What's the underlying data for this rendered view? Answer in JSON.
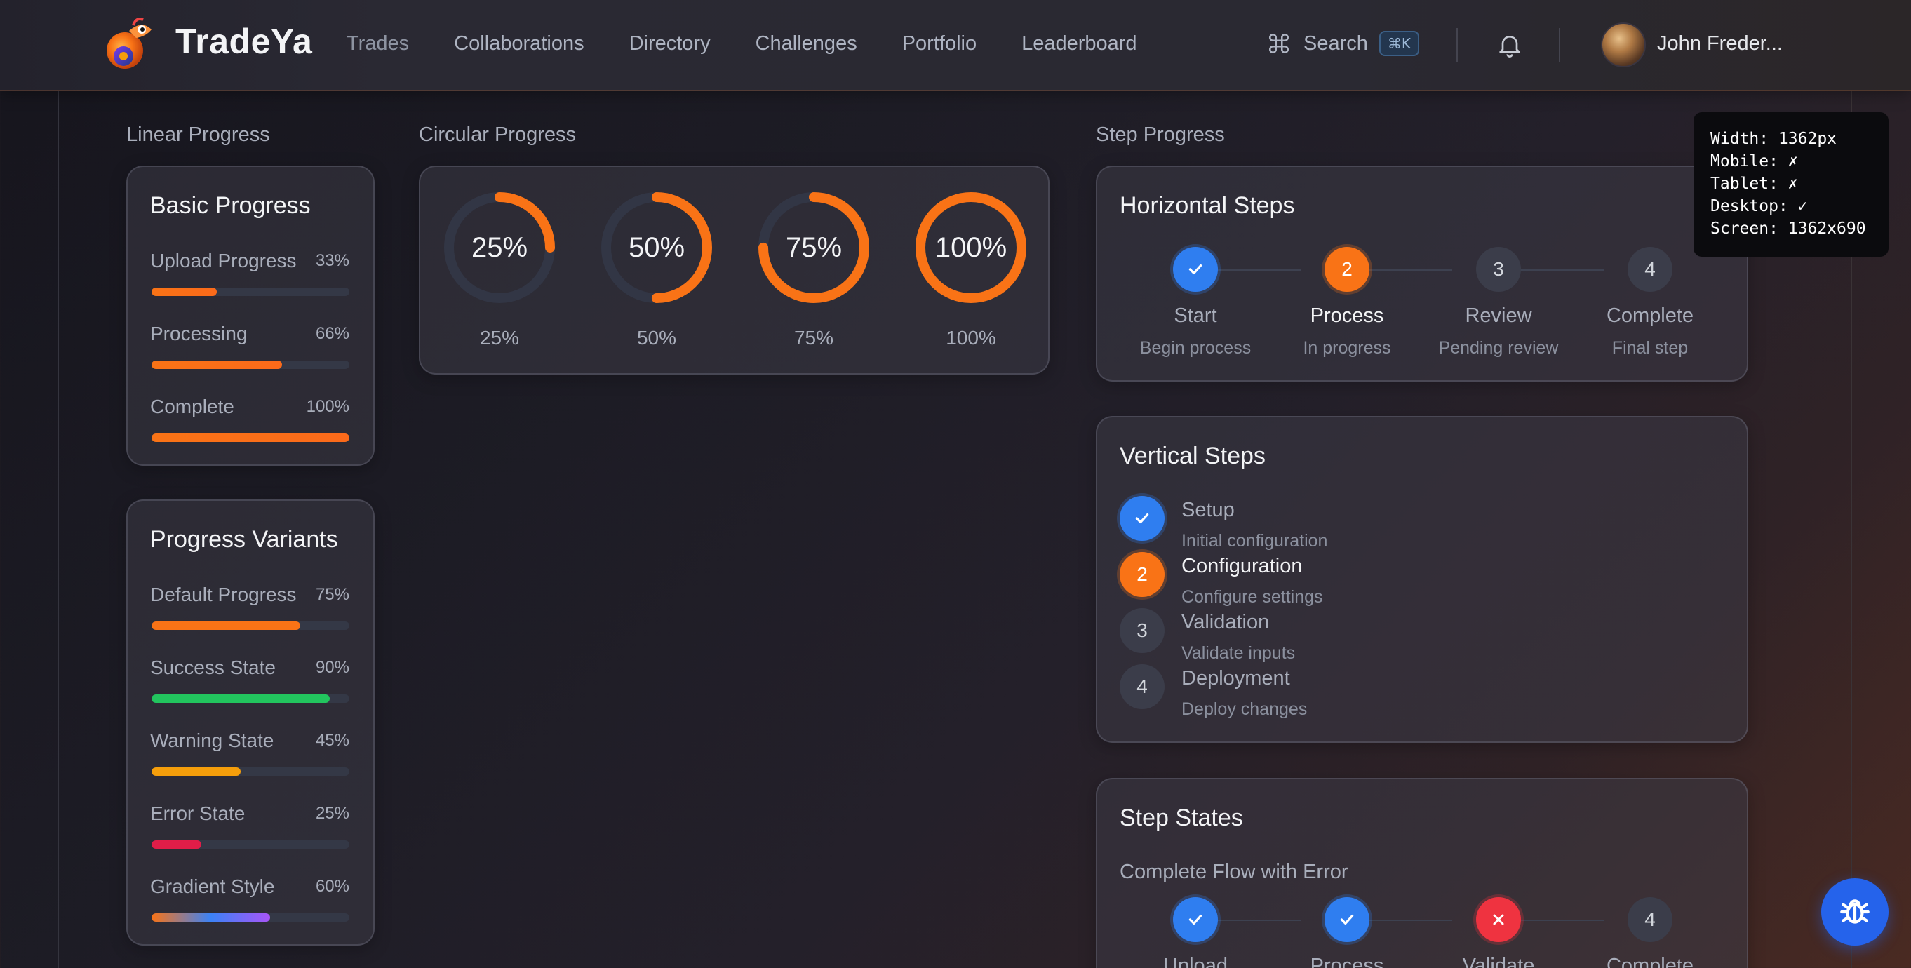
{
  "header": {
    "brand": "TradeYa",
    "nav": [
      "Trades",
      "Collaborations",
      "Directory",
      "Challenges",
      "Portfolio",
      "Leaderboard"
    ],
    "search_label": "Search",
    "search_shortcut": "⌘K",
    "username": "John Freder..."
  },
  "sections": {
    "linear": "Linear Progress",
    "circular": "Circular Progress",
    "step": "Step Progress"
  },
  "basic_progress": {
    "title": "Basic Progress",
    "items": [
      {
        "label": "Upload Progress",
        "pct": "33%",
        "value": 33
      },
      {
        "label": "Processing",
        "pct": "66%",
        "value": 66
      },
      {
        "label": "Complete",
        "pct": "100%",
        "value": 100
      }
    ]
  },
  "progress_variants": {
    "title": "Progress Variants",
    "items": [
      {
        "label": "Default Progress",
        "pct": "75%",
        "value": 75,
        "color": "#f97316"
      },
      {
        "label": "Success State",
        "pct": "90%",
        "value": 90,
        "color": "#22c55e"
      },
      {
        "label": "Warning State",
        "pct": "45%",
        "value": 45,
        "color": "#f59e0b"
      },
      {
        "label": "Error State",
        "pct": "25%",
        "value": 25,
        "color": "#e11d48"
      },
      {
        "label": "Gradient Style",
        "pct": "60%",
        "value": 60,
        "color": "gradient"
      }
    ]
  },
  "circular": [
    {
      "center": "25%",
      "caption": "25%",
      "value": 25
    },
    {
      "center": "50%",
      "caption": "50%",
      "value": 50
    },
    {
      "center": "75%",
      "caption": "75%",
      "value": 75
    },
    {
      "center": "100%",
      "caption": "100%",
      "value": 100
    }
  ],
  "horizontal_steps": {
    "title": "Horizontal Steps",
    "steps": [
      {
        "num": "1",
        "name": "Start",
        "desc": "Begin process",
        "state": "done"
      },
      {
        "num": "2",
        "name": "Process",
        "desc": "In progress",
        "state": "active"
      },
      {
        "num": "3",
        "name": "Review",
        "desc": "Pending review",
        "state": "pending"
      },
      {
        "num": "4",
        "name": "Complete",
        "desc": "Final step",
        "state": "pending"
      }
    ]
  },
  "vertical_steps": {
    "title": "Vertical Steps",
    "steps": [
      {
        "num": "1",
        "name": "Setup",
        "desc": "Initial configuration",
        "state": "done"
      },
      {
        "num": "2",
        "name": "Configuration",
        "desc": "Configure settings",
        "state": "active"
      },
      {
        "num": "3",
        "name": "Validation",
        "desc": "Validate inputs",
        "state": "pending"
      },
      {
        "num": "4",
        "name": "Deployment",
        "desc": "Deploy changes",
        "state": "pending"
      }
    ]
  },
  "step_states": {
    "title": "Step States",
    "subtitle": "Complete Flow with Error",
    "steps": [
      {
        "num": "1",
        "name": "Upload",
        "state": "done"
      },
      {
        "num": "2",
        "name": "Process",
        "state": "done"
      },
      {
        "num": "3",
        "name": "Validate",
        "state": "error"
      },
      {
        "num": "4",
        "name": "Complete",
        "state": "pending"
      }
    ]
  },
  "debug_tooltip": {
    "lines": [
      "Width: 1362px",
      "Mobile: ✗",
      "Tablet: ✗",
      "Desktop: ✓",
      "Screen: 1362x690"
    ]
  },
  "colors": {
    "accent": "#f97316",
    "done": "#2f7ef0",
    "error": "#ef3340",
    "fab": "#2563eb"
  }
}
